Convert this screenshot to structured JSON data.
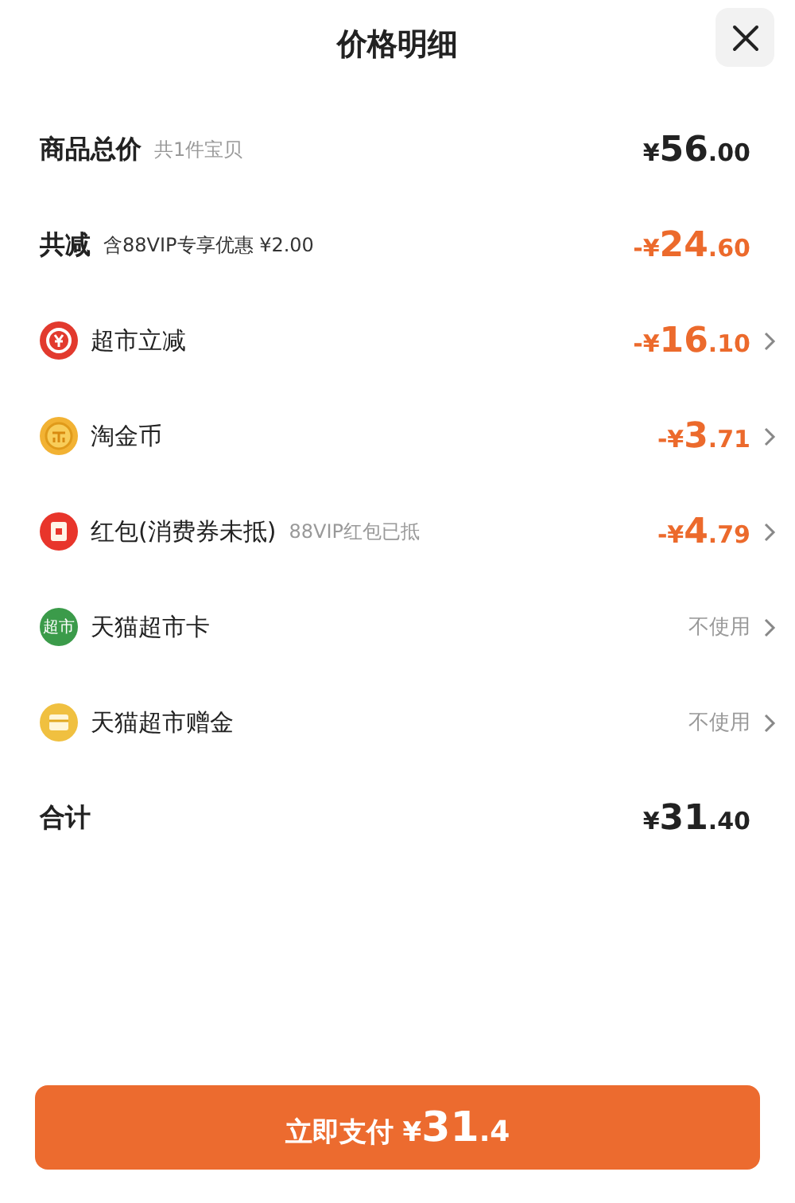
{
  "title": "价格明细",
  "rows": [
    {
      "kind": "summary",
      "label": "商品总价",
      "note": "共1件宝贝",
      "value": {
        "sign": "¥",
        "whole": "56",
        "fraction": ".00"
      },
      "discount": false,
      "chevron": false
    },
    {
      "kind": "summary",
      "label": "共减",
      "note": "含88VIP专享优惠 ¥2.00",
      "value": {
        "sign": "-¥",
        "whole": "24",
        "fraction": ".60"
      },
      "discount": true,
      "chevron": false
    },
    {
      "kind": "item",
      "label": "超市立减",
      "value": {
        "sign": "-¥",
        "whole": "16",
        "fraction": ".10"
      },
      "discount": true,
      "chevron": true
    },
    {
      "kind": "item",
      "label": "淘金币",
      "value": {
        "sign": "-¥",
        "whole": "3",
        "fraction": ".71"
      },
      "discount": true,
      "chevron": true
    },
    {
      "kind": "item",
      "label": "红包(消费券未抵)",
      "note": "88VIP红包已抵",
      "value": {
        "sign": "-¥",
        "whole": "4",
        "fraction": ".79"
      },
      "discount": true,
      "chevron": true
    },
    {
      "kind": "item",
      "badge": "超市",
      "label": "天猫超市卡",
      "status": "不使用",
      "chevron": true
    },
    {
      "kind": "item",
      "label": "天猫超市赠金",
      "status": "不使用",
      "chevron": true
    },
    {
      "kind": "summary",
      "label": "合计",
      "value": {
        "sign": "¥",
        "whole": "31",
        "fraction": ".40"
      },
      "discount": false,
      "chevron": false
    }
  ],
  "pay_button": {
    "label": "立即支付",
    "sign": "¥",
    "whole": "31",
    "fraction": ".4"
  }
}
